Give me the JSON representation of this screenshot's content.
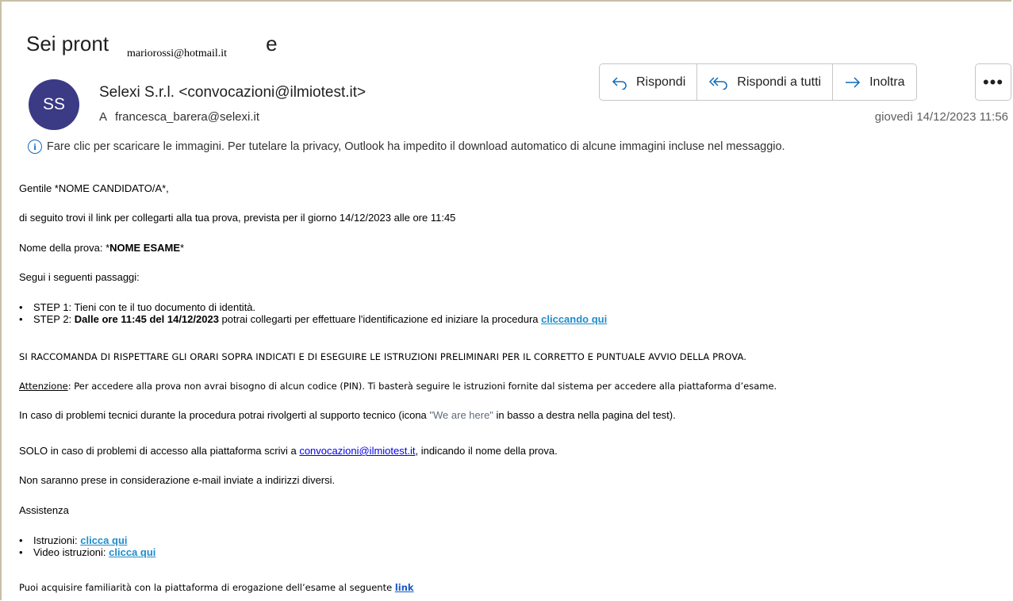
{
  "email": {
    "subject": "Sei pront",
    "subject_tail": "e",
    "overlay_address": "mariorossi@hotmail.it",
    "avatar_initials": "SS",
    "sender": "Selexi S.r.l. <convocazioni@ilmiotest.it>",
    "to_prefix": "A",
    "to_address": "francesca_barera@selexi.it",
    "date": "giovedì 14/12/2023 11:56",
    "info_bar": "Fare clic per scaricare le immagini. Per tutelare la privacy, Outlook ha impedito il download automatico di alcune immagini incluse nel messaggio.",
    "actions": {
      "reply": "Rispondi",
      "reply_all": "Rispondi a tutti",
      "forward": "Inoltra",
      "more": "•••"
    }
  },
  "body": {
    "greeting": "Gentile *NOME CANDIDATO/A*,",
    "intro": "di seguito trovi il link per collegarti alla tua prova, prevista per il giorno 14/12/2023 alle ore 11:45",
    "exam_prefix": "Nome della prova: *",
    "exam_name": "NOME ESAME",
    "exam_suffix": "*",
    "steps_intro": "Segui i seguenti passaggi:",
    "step1": "STEP 1: Tieni con te il tuo documento di identità.",
    "step2_prefix": "STEP 2: ",
    "step2_bold": "Dalle ore 11:45 del 14/12/2023",
    "step2_text": " potrai collegarti per effettuare l'identificazione ed iniziare la procedura ",
    "step2_link": "cliccando qui",
    "warning": "SI RACCOMANDA DI RISPETTARE GLI ORARI SOPRA INDICATI E DI ESEGUIRE LE ISTRUZIONI PRELIMINARI PER IL CORRETTO E PUNTUALE AVVIO DELLA PROVA.",
    "attention_label": "Attenzione",
    "attention_text": ": Per accedere alla prova non avrai bisogno di alcun codice (PIN). Ti basterà seguire le istruzioni fornite dal sistema per accedere alla piattaforma d’esame.",
    "support_prefix": "In caso di problemi tecnici durante la procedura potrai rivolgerti al supporto tecnico (icona ",
    "support_highlight": "\"We are here\"",
    "support_suffix": " in basso a destra nella pagina del test).",
    "solo_prefix": "SOLO in caso di problemi di accesso alla piattaforma scrivi a ",
    "solo_email": "convocazioni@ilmiotest.it",
    "solo_suffix": ", indicando il nome della prova.",
    "no_other": "Non saranno prese in considerazione e-mail inviate a indirizzi diversi.",
    "assistance": "Assistenza",
    "instr_label": "Istruzioni: ",
    "instr_link": "clicca qui",
    "video_label": "Video istruzioni: ",
    "video_link": "clicca qui",
    "familiar_text": "Puoi acquisire familiarità con la piattaforma di erogazione dell’esame al seguente ",
    "familiar_link": "link"
  }
}
